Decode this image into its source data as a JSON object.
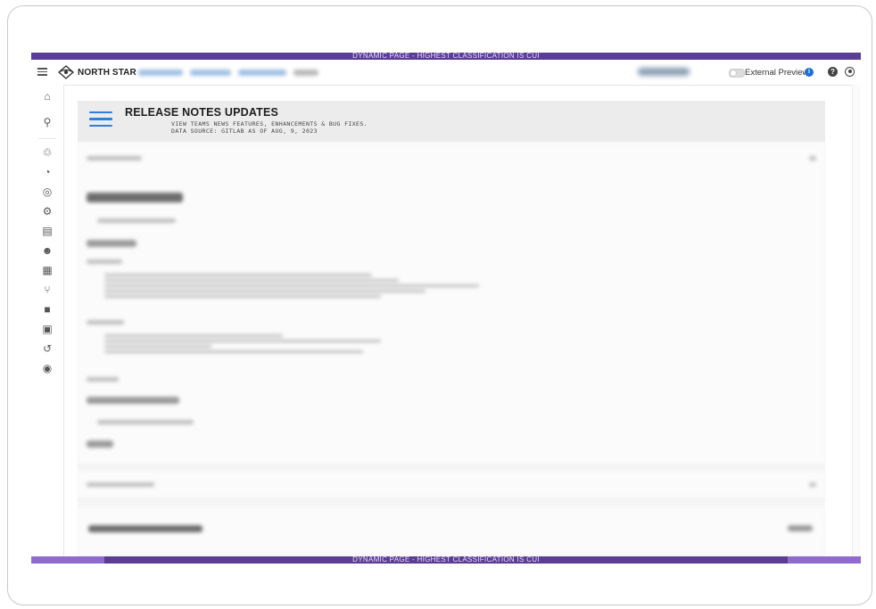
{
  "banner": {
    "top": "DYNAMIC PAGE - HIGHEST CLASSIFICATION IS CUI",
    "bottom": "DYNAMIC PAGE - HIGHEST CLASSIFICATION IS CUI"
  },
  "topbar": {
    "brand": "NORTH STAR",
    "external_preview_label": "External Preview",
    "info_glyph": "i",
    "help_glyph": "?"
  },
  "sidebar": {
    "items": [
      {
        "icon": "home-icon",
        "glyph": "⌂"
      },
      {
        "icon": "search-icon",
        "glyph": "⚲"
      },
      {
        "icon": "recycle-icon",
        "glyph": "♲"
      },
      {
        "icon": "compass-icon",
        "glyph": "◔"
      },
      {
        "icon": "target-icon",
        "glyph": "◎"
      },
      {
        "icon": "gear-icon",
        "glyph": "⚙"
      },
      {
        "icon": "toolbox-icon",
        "glyph": "▤"
      },
      {
        "icon": "smiley-icon",
        "glyph": "☻"
      },
      {
        "icon": "dashboard-icon",
        "glyph": "▦"
      },
      {
        "icon": "branch-icon",
        "glyph": "⑂"
      },
      {
        "icon": "book-icon",
        "glyph": "■"
      },
      {
        "icon": "cast-icon",
        "glyph": "▣"
      },
      {
        "icon": "refresh-icon",
        "glyph": "↺"
      },
      {
        "icon": "target-alt-icon",
        "glyph": "◉"
      }
    ]
  },
  "release": {
    "title": "RELEASE NOTES UPDATES",
    "subtitle_line1": "VIEW TEAMS NEWS FEATURES, ENHANCEMENTS & BUG FIXES.",
    "subtitle_line2": "DATA SOURCE: GITLAB AS OF AUG, 9, 2023"
  },
  "colors": {
    "banner": "#5b3d95",
    "accent": "#2f7ee0",
    "info": "#1f6fd6"
  }
}
